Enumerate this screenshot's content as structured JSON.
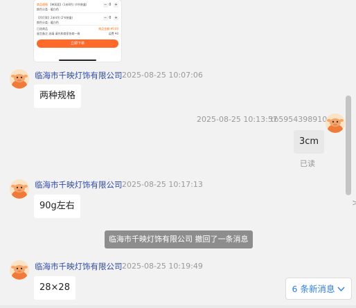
{
  "product_card": {
    "row1_tag": "商品规格",
    "row1_title": "【单双面】(1米8吊) (4节装盒)",
    "row1_note": "颜色分类 · 暖白色",
    "row1_qty": "0",
    "row2_title": "【吊灯款】2米4吊 (2节装盒)",
    "row2_note": "颜色分类 · 暖白色",
    "row2_qty": "0",
    "summary_label": "已选商品",
    "summary_price": "商品金额 ¥0.00",
    "note_label": "留言备注",
    "note_placeholder": "选填 请先和商家协商一致",
    "shipping": "运费 ¥0",
    "buy_button": "立即下单"
  },
  "messages": [
    {
      "sender": "临海市千映灯饰有限公司",
      "time": "2025-08-25 10:07:06",
      "text": "两种规格"
    },
    {
      "time": "2025-08-25 10:13:57",
      "user": "tb5954398910",
      "text": "3cm",
      "status": "已读"
    },
    {
      "sender": "临海市千映灯饰有限公司",
      "time": "2025-08-25 10:17:13",
      "text": "90g左右"
    },
    {
      "system": "临海市千映灯饰有限公司 撤回了一条消息"
    },
    {
      "sender": "临海市千映灯饰有限公司",
      "time": "2025-08-25 10:19:49",
      "text": "28×28"
    }
  ],
  "new_messages": {
    "label": "6 条新消息",
    "icon": "chevron-down-icon"
  },
  "side_arrow": ">",
  "colors": {
    "sender": "#2f4aa8",
    "orange": "#ff6a2a",
    "link": "#2f7fe0"
  }
}
